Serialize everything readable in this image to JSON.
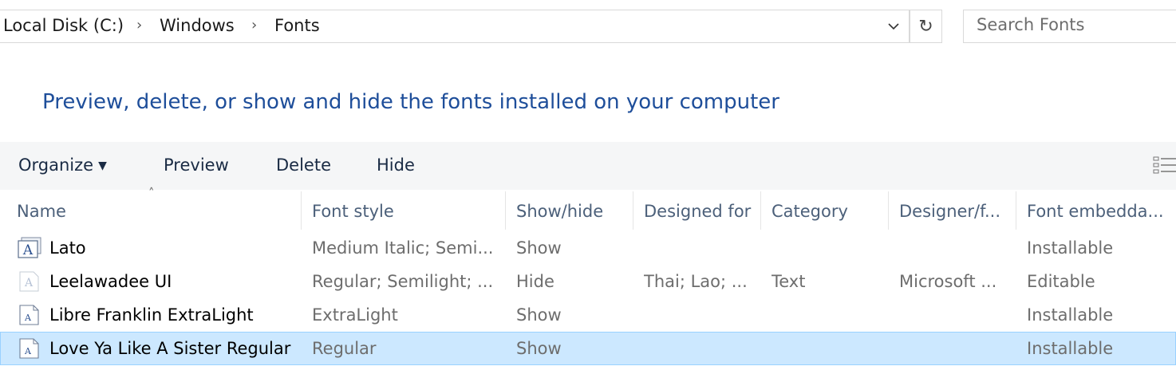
{
  "address_bar": {
    "breadcrumbs": [
      "Local Disk (C:)",
      "Windows",
      "Fonts"
    ],
    "separator": "›",
    "dropdown_glyph": "⌄",
    "refresh_glyph": "↻"
  },
  "search": {
    "placeholder": "Search Fonts",
    "value": ""
  },
  "heading": "Preview, delete, or show and hide the fonts installed on your computer",
  "toolbar": {
    "organize_label": "Organize",
    "organize_caret": "▼",
    "preview_label": "Preview",
    "delete_label": "Delete",
    "hide_label": "Hide",
    "view_icon": "details-view-icon"
  },
  "sort_indicator": "˄",
  "columns": [
    "Name",
    "Font style",
    "Show/hide",
    "Designed for",
    "Category",
    "Designer/f...",
    "Font embedda..."
  ],
  "rows": [
    {
      "name": "Lato",
      "font_style": "Medium Italic; Semi...",
      "show_hide": "Show",
      "designed_for": "",
      "category": "",
      "designer": "",
      "embeddability": "Installable",
      "icon": "font-family-icon",
      "selected": false
    },
    {
      "name": "Leelawadee UI",
      "font_style": "Regular; Semilight; ...",
      "show_hide": "Hide",
      "designed_for": "Thai; Lao; ...",
      "category": "Text",
      "designer": "Microsoft ...",
      "embeddability": "Editable",
      "icon": "font-hidden-icon",
      "selected": false
    },
    {
      "name": "Libre Franklin ExtraLight",
      "font_style": "ExtraLight",
      "show_hide": "Show",
      "designed_for": "",
      "category": "",
      "designer": "",
      "embeddability": "Installable",
      "icon": "font-file-icon",
      "selected": false
    },
    {
      "name": "Love Ya Like A Sister Regular",
      "font_style": "Regular",
      "show_hide": "Show",
      "designed_for": "",
      "category": "",
      "designer": "",
      "embeddability": "Installable",
      "icon": "font-file-icon",
      "selected": true
    }
  ],
  "colors": {
    "heading": "#1e4e9a",
    "toolbar_bg": "#f5f6f7",
    "selected_bg": "#cce8ff",
    "selected_border": "#99d1ff",
    "secondary_text": "#6d6d6d"
  }
}
